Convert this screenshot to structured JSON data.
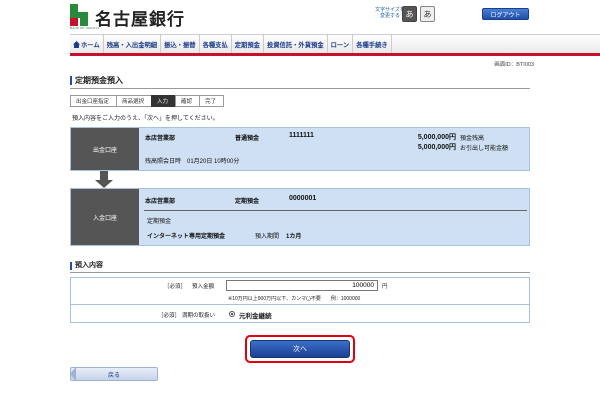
{
  "header": {
    "logo_sub": "BANK OF NAGOYA",
    "bank_name": "名古屋銀行",
    "font_size_label": "文字サイズを変更する",
    "font_small": "あ",
    "font_large": "あ",
    "logout": "ログアウト"
  },
  "nav": {
    "items": [
      {
        "label": "ホーム",
        "icon": "home-icon"
      },
      {
        "label": "残高・入出金明細"
      },
      {
        "label": "振込・振替"
      },
      {
        "label": "各種支払"
      },
      {
        "label": "定期預金"
      },
      {
        "label": "投資信託・外貨預金"
      },
      {
        "label": "ローン"
      },
      {
        "label": "各種手続き"
      }
    ]
  },
  "screen_id": "画面ID：BTI003",
  "page_title": "定期預金預入",
  "steps": [
    "出金口座指定",
    "商品選択",
    "入力",
    "確認",
    "完了"
  ],
  "active_step": 2,
  "instruction": "預入内容をご入力のうえ、「次へ」を押してください。",
  "withdraw": {
    "label": "出金口座",
    "branch": "本店営業部",
    "type": "普通預金",
    "account_no": "1111111",
    "balance": "5,000,000円",
    "balance_label": "預金残高",
    "available": "5,000,000円",
    "available_label": "お引出し可能金額",
    "as_of": "残高照会日時　01月20日 10時00分"
  },
  "deposit": {
    "label": "入金口座",
    "branch": "本店営業部",
    "type": "定期預金",
    "account_no": "0000001",
    "product_category": "定期預金",
    "product_name": "インターネット専用定期預金",
    "term_label": "預入期間",
    "term": "1カ月"
  },
  "form": {
    "section_title": "預入内容",
    "amount_required": "［必須］",
    "amount_label": "預入金額",
    "amount_value": "100000",
    "amount_unit": "円",
    "amount_note": "※10万円以上900万円以下、カンマ(,)不要　　例：1000000",
    "maturity_required": "［必須］",
    "maturity_label": "満期の取扱い",
    "maturity_option": "元利金継続"
  },
  "next_button": "次へ",
  "back_button": "戻る",
  "colors": {
    "accent_red": "#c8102e",
    "highlight_red": "#e0000f",
    "nav_blue": "#1a3a8a",
    "box_blue": "#cfe0f4",
    "label_gray": "#555555"
  }
}
